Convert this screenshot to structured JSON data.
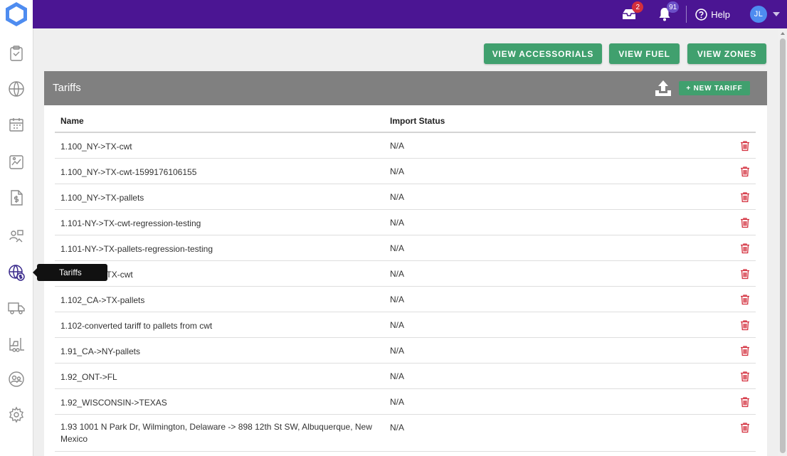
{
  "app": {
    "logo_icon": "hexagon-logo-icon",
    "brand_color": "#4b1593",
    "accent_green": "#40a06e"
  },
  "topbar": {
    "messages_badge": "2",
    "notifications_badge": "91",
    "help_label": "Help",
    "user_initials": "JL"
  },
  "sidebar": {
    "items": [
      {
        "icon": "clipboard-icon"
      },
      {
        "icon": "globe-route-icon"
      },
      {
        "icon": "calendar-icon"
      },
      {
        "icon": "report-icon"
      },
      {
        "icon": "invoice-icon"
      },
      {
        "icon": "contacts-icon"
      },
      {
        "icon": "globe-dollar-icon",
        "active": true
      },
      {
        "icon": "truck-icon"
      },
      {
        "icon": "forklift-icon"
      },
      {
        "icon": "users-icon"
      },
      {
        "icon": "gear-icon"
      }
    ],
    "tooltip": "Tariffs"
  },
  "actions": {
    "view_accessorials": "VIEW ACCESSORIALS",
    "view_fuel": "VIEW FUEL",
    "view_zones": "VIEW ZONES"
  },
  "card": {
    "title": "Tariffs",
    "new_tariff_label": "+ NEW TARIFF"
  },
  "table": {
    "columns": [
      "Name",
      "Import Status"
    ],
    "rows": [
      {
        "name": "1.100_NY->TX-cwt",
        "status": "N/A"
      },
      {
        "name": "1.100_NY->TX-cwt-1599176106155",
        "status": "N/A"
      },
      {
        "name": "1.100_NY->TX-pallets",
        "status": "N/A"
      },
      {
        "name": "1.101-NY->TX-cwt-regression-testing",
        "status": "N/A"
      },
      {
        "name": "1.101-NY->TX-pallets-regression-testing",
        "status": "N/A"
      },
      {
        "name": "1.102_CA->TX-cwt",
        "status": "N/A"
      },
      {
        "name": "1.102_CA->TX-pallets",
        "status": "N/A"
      },
      {
        "name": "1.102-converted tariff to pallets from cwt",
        "status": "N/A"
      },
      {
        "name": "1.91_CA->NY-pallets",
        "status": "N/A"
      },
      {
        "name": "1.92_ONT->FL",
        "status": "N/A"
      },
      {
        "name": "1.92_WISCONSIN->TEXAS",
        "status": "N/A"
      },
      {
        "name": "1.93 1001 N Park Dr, Wilmington, Delaware -> 898 12th St SW, Albuquerque, New Mexico",
        "status": "N/A"
      }
    ]
  }
}
